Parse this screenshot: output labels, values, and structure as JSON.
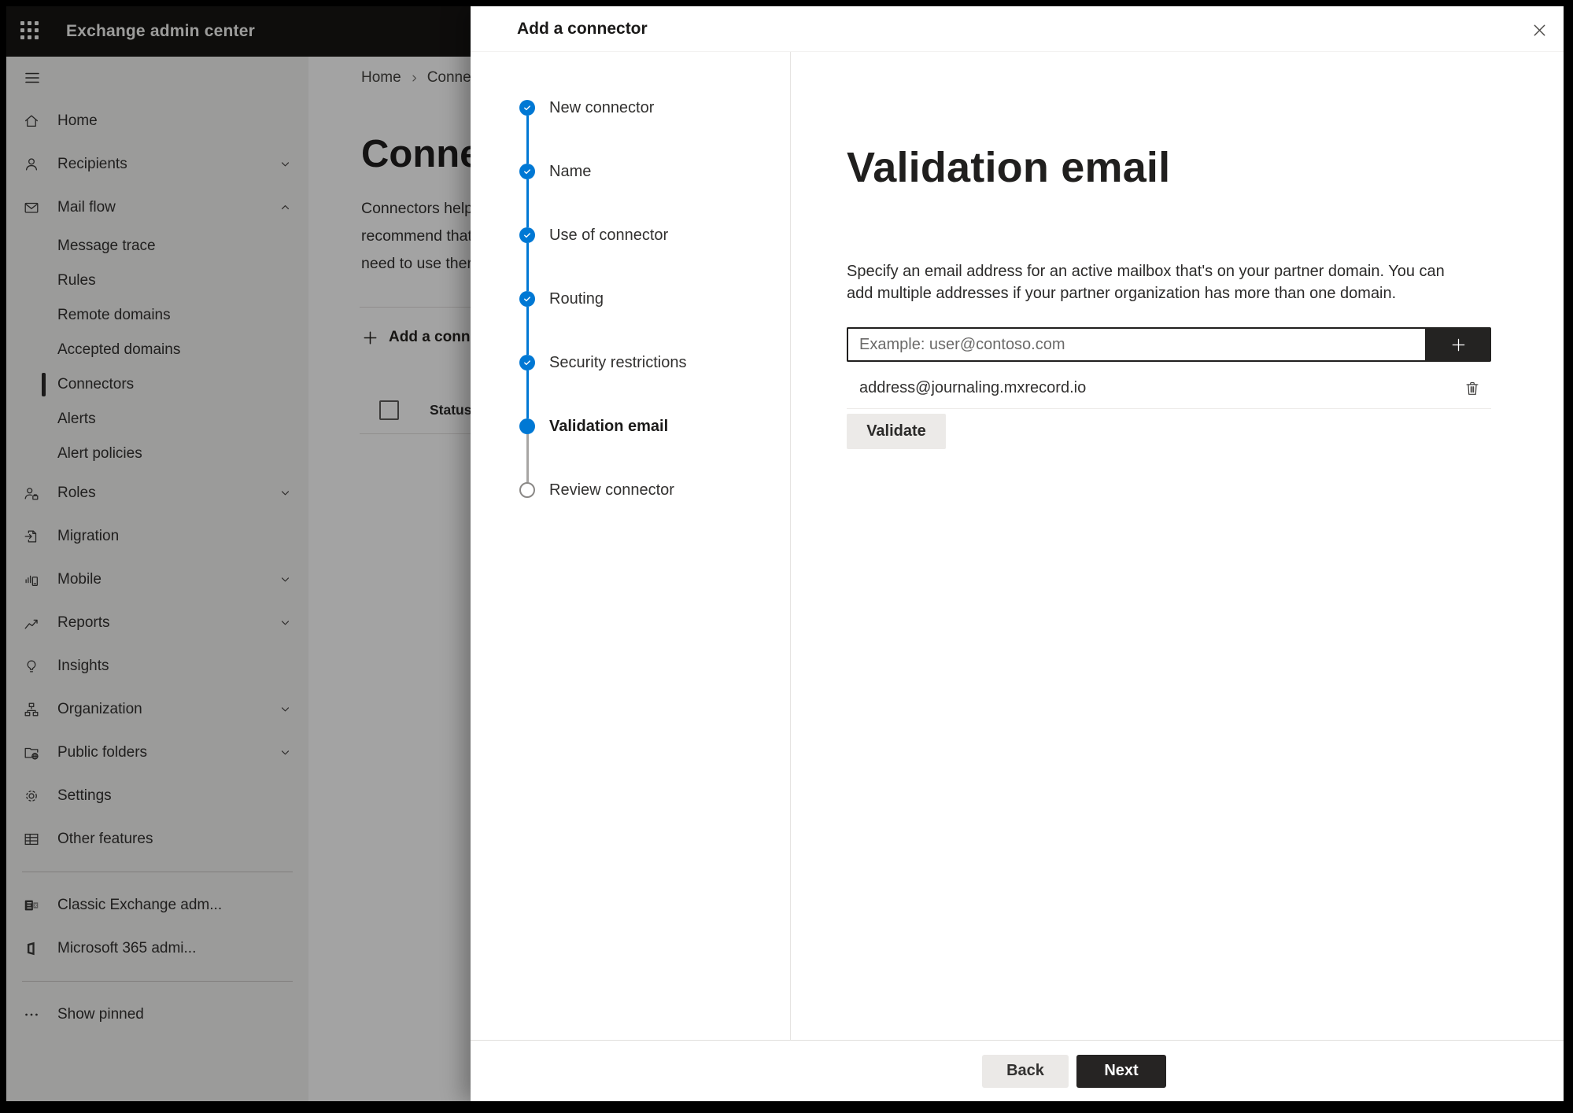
{
  "topbar": {
    "app_title": "Exchange admin center",
    "waffle_icon": "app-launcher-icon"
  },
  "sidebar": {
    "items": [
      {
        "label": "Home",
        "icon": "home-icon"
      },
      {
        "label": "Recipients",
        "icon": "person-icon",
        "chevron": "chevron-down-icon"
      },
      {
        "label": "Mail flow",
        "icon": "mail-icon",
        "chevron": "chevron-up-icon"
      },
      {
        "label": "Message trace",
        "type": "sub"
      },
      {
        "label": "Rules",
        "type": "sub"
      },
      {
        "label": "Remote domains",
        "type": "sub"
      },
      {
        "label": "Accepted domains",
        "type": "sub"
      },
      {
        "label": "Connectors",
        "type": "sub",
        "selected": true
      },
      {
        "label": "Alerts",
        "type": "sub"
      },
      {
        "label": "Alert policies",
        "type": "sub"
      },
      {
        "label": "Roles",
        "icon": "roles-icon",
        "chevron": "chevron-down-icon"
      },
      {
        "label": "Migration",
        "icon": "migration-icon"
      },
      {
        "label": "Mobile",
        "icon": "mobile-icon",
        "chevron": "chevron-down-icon"
      },
      {
        "label": "Reports",
        "icon": "reports-icon",
        "chevron": "chevron-down-icon"
      },
      {
        "label": "Insights",
        "icon": "insights-icon"
      },
      {
        "label": "Organization",
        "icon": "org-icon",
        "chevron": "chevron-down-icon"
      },
      {
        "label": "Public folders",
        "icon": "public-folders-icon",
        "chevron": "chevron-down-icon"
      },
      {
        "label": "Settings",
        "icon": "settings-icon"
      },
      {
        "label": "Other features",
        "icon": "other-features-icon"
      },
      {
        "type": "divider"
      },
      {
        "label": "Classic Exchange adm...",
        "icon": "classic-exchange-icon"
      },
      {
        "label": "Microsoft 365 admi...",
        "icon": "m365-icon"
      },
      {
        "type": "divider"
      },
      {
        "label": "Show pinned",
        "icon": "pinned-icon"
      }
    ]
  },
  "background": {
    "breadcrumb": {
      "home": "Home",
      "current": "Conne"
    },
    "page_title": "Connect",
    "description_lines": [
      "Connectors help",
      "recommend that",
      "need to use ther"
    ],
    "add_button_label": "Add a conn",
    "table": {
      "status_header": "Status"
    }
  },
  "modal": {
    "title": "Add a connector",
    "steps": [
      {
        "label": "New connector",
        "state": "done",
        "line": "blue"
      },
      {
        "label": "Name",
        "state": "done",
        "line": "blue"
      },
      {
        "label": "Use of connector",
        "state": "done",
        "line": "blue"
      },
      {
        "label": "Routing",
        "state": "done",
        "line": "blue"
      },
      {
        "label": "Security restrictions",
        "state": "done",
        "line": "blue"
      },
      {
        "label": "Validation email",
        "state": "current",
        "line": "gray"
      },
      {
        "label": "Review connector",
        "state": "upcoming"
      }
    ],
    "content": {
      "heading": "Validation email",
      "description": "Specify an email address for an active mailbox that's on your partner domain. You can add multiple addresses if your partner organization has more than one domain.",
      "email_input_placeholder": "Example: user@contoso.com",
      "email_addresses": [
        "address@journaling.mxrecord.io"
      ],
      "validate_button": "Validate"
    },
    "footer": {
      "back_button": "Back",
      "next_button": "Next"
    }
  },
  "colors": {
    "accent": "#0078d4",
    "step_done": "#0078d4",
    "topbar": "#161514",
    "sidebar": "#f3f2f1"
  }
}
